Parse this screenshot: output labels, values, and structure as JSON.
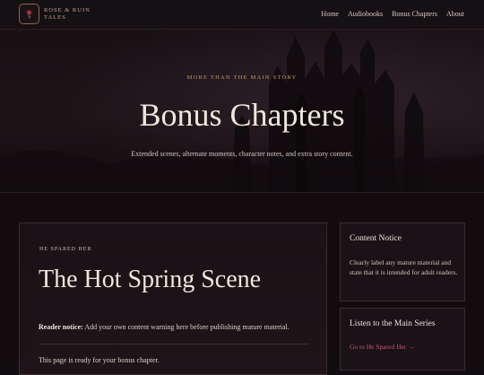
{
  "brand": {
    "line1": "ROSE & RUIN",
    "line2": "TALES",
    "logo_icon": "rose-icon"
  },
  "nav": [
    {
      "label": "Home"
    },
    {
      "label": "Audiobooks"
    },
    {
      "label": "Bonus Chapters"
    },
    {
      "label": "About"
    }
  ],
  "hero": {
    "eyebrow": "MORE THAN THE MAIN STORY",
    "title": "Bonus Chapters",
    "subtitle": "Extended scenes, alternate moments, character notes, and extra story content."
  },
  "card": {
    "eyebrow": "HE SPARED HER",
    "title": "The Hot Spring Scene",
    "notice_label": "Reader notice:",
    "notice_text": " Add your own content warning here before publishing mature material.",
    "ready_text": "This page is ready for your bonus chapter."
  },
  "sidebar": {
    "content_notice": {
      "heading": "Content Notice",
      "text": "Clearly label any mature material and state that it is intended for adult readers."
    },
    "listen": {
      "heading": "Listen to the Main Series",
      "link": "Go to He Spared Her →"
    }
  },
  "colors": {
    "accent_gold": "#c89a5e",
    "link_rose": "#c25a6c",
    "background": "#120d10"
  }
}
